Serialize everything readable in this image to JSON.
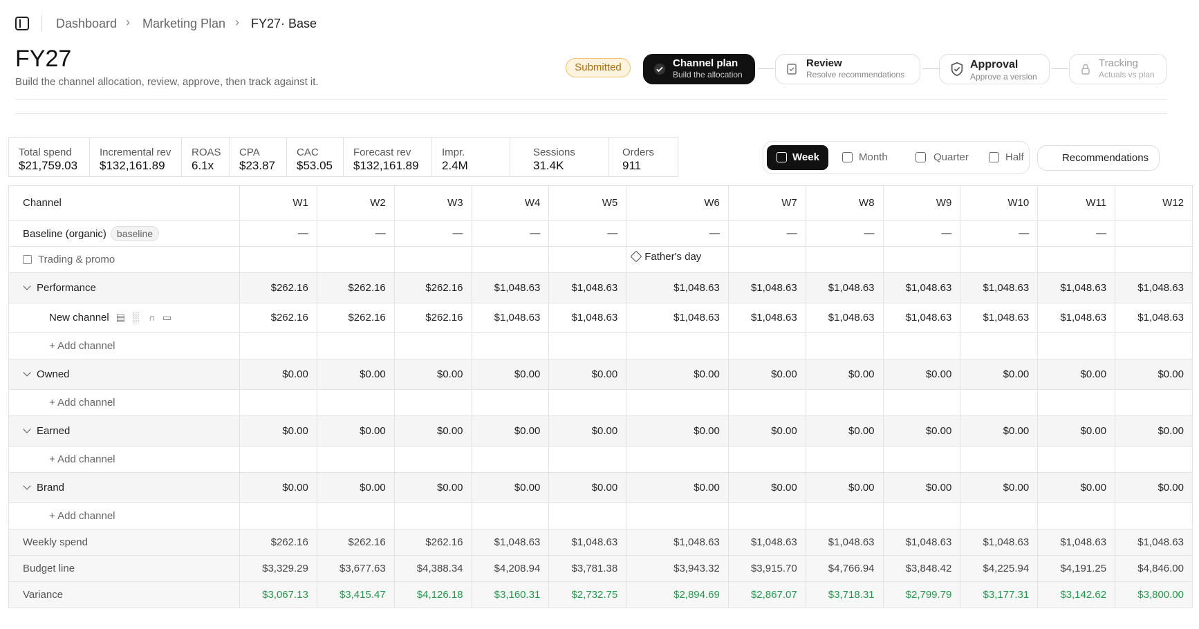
{
  "breadcrumb": [
    "Dashboard",
    "Marketing Plan",
    "FY27· Base"
  ],
  "page": {
    "title": "FY27",
    "subtitle": "Build the channel allocation, review, approve, then track against it.",
    "status": "Submitted"
  },
  "steps": [
    {
      "title": "Channel plan",
      "subtitle": "Build the allocation",
      "icon": "check-circle-icon",
      "state": "active"
    },
    {
      "title": "Review",
      "subtitle": "Resolve recommendations",
      "icon": "checkbox-icon",
      "state": "normal"
    },
    {
      "title": "Approval",
      "subtitle": "Approve a version",
      "icon": "shield-check-icon",
      "state": "normal"
    },
    {
      "title": "Tracking",
      "subtitle": "Actuals vs plan",
      "icon": "lock-icon",
      "state": "disabled"
    }
  ],
  "kpis": [
    {
      "label": "Total spend",
      "value": "$21,759.03"
    },
    {
      "label": "Incremental rev",
      "value": "$132,161.89"
    },
    {
      "label": "ROAS",
      "value": "6.1x"
    },
    {
      "label": "CPA",
      "value": "$23.87"
    },
    {
      "label": "CAC",
      "value": "$53.05"
    },
    {
      "label": "Forecast rev",
      "value": "$132,161.89"
    },
    {
      "label": "Impr.",
      "value": "2.4M"
    },
    {
      "label": "Sessions",
      "value": "31.4K"
    },
    {
      "label": "Orders",
      "value": "911"
    }
  ],
  "views": [
    {
      "label": "Week",
      "icon": "panel-icon",
      "active": true
    },
    {
      "label": "Month",
      "icon": "calendar-icon",
      "active": false
    },
    {
      "label": "Quarter",
      "icon": "grid-icon",
      "active": false
    },
    {
      "label": "Half",
      "icon": "calendar-icon",
      "active": false
    }
  ],
  "recommendations_label": "Recommendations",
  "grid": {
    "channel_header": "Channel",
    "weeks": [
      "W1",
      "W2",
      "W3",
      "W4",
      "W5",
      "W6",
      "W7",
      "W8",
      "W9",
      "W10",
      "W11",
      "W12"
    ],
    "baseline": {
      "label": "Baseline (organic)",
      "pill": "baseline",
      "dash": "—"
    },
    "trading": {
      "label": "Trading & promo",
      "event": "Father's day"
    },
    "add_channel": "+ Add channel",
    "groups": [
      {
        "name": "Performance",
        "values": [
          "$262.16",
          "$262.16",
          "$262.16",
          "$1,048.63",
          "$1,048.63",
          "$1,048.63",
          "$1,048.63",
          "$1,048.63",
          "$1,048.63",
          "$1,048.63",
          "$1,048.63",
          "$1,048.63"
        ],
        "channels": [
          {
            "name": "New channel",
            "values": [
              "$262.16",
              "$262.16",
              "$262.16",
              "$1,048.63",
              "$1,048.63",
              "$1,048.63",
              "$1,048.63",
              "$1,048.63",
              "$1,048.63",
              "$1,048.63",
              "$1,048.63",
              "$1,048.63"
            ]
          }
        ]
      },
      {
        "name": "Owned",
        "values": [
          "$0.00",
          "$0.00",
          "$0.00",
          "$0.00",
          "$0.00",
          "$0.00",
          "$0.00",
          "$0.00",
          "$0.00",
          "$0.00",
          "$0.00",
          "$0.00"
        ],
        "channels": []
      },
      {
        "name": "Earned",
        "values": [
          "$0.00",
          "$0.00",
          "$0.00",
          "$0.00",
          "$0.00",
          "$0.00",
          "$0.00",
          "$0.00",
          "$0.00",
          "$0.00",
          "$0.00",
          "$0.00"
        ],
        "channels": []
      },
      {
        "name": "Brand",
        "values": [
          "$0.00",
          "$0.00",
          "$0.00",
          "$0.00",
          "$0.00",
          "$0.00",
          "$0.00",
          "$0.00",
          "$0.00",
          "$0.00",
          "$0.00",
          "$0.00"
        ],
        "channels": []
      }
    ],
    "totals": [
      {
        "label": "Weekly spend",
        "values": [
          "$262.16",
          "$262.16",
          "$262.16",
          "$1,048.63",
          "$1,048.63",
          "$1,048.63",
          "$1,048.63",
          "$1,048.63",
          "$1,048.63",
          "$1,048.63",
          "$1,048.63",
          "$1,048.63"
        ]
      },
      {
        "label": "Budget line",
        "values": [
          "$3,329.29",
          "$3,677.63",
          "$4,388.34",
          "$4,208.94",
          "$3,781.38",
          "$3,943.32",
          "$3,915.70",
          "$4,766.94",
          "$3,848.42",
          "$4,225.94",
          "$4,191.25",
          "$4,846.00"
        ]
      },
      {
        "label": "Variance",
        "values": [
          "$3,067.13",
          "$3,415.47",
          "$4,126.18",
          "$3,160.31",
          "$2,732.75",
          "$2,894.69",
          "$2,867.07",
          "$3,718.31",
          "$2,799.79",
          "$3,177.31",
          "$3,142.62",
          "$3,800.00"
        ]
      }
    ]
  },
  "colors": {
    "positive": "#1f9a4a",
    "accent": "#111111",
    "submitted_bg": "#fdf3de",
    "submitted_text": "#b06c00"
  }
}
